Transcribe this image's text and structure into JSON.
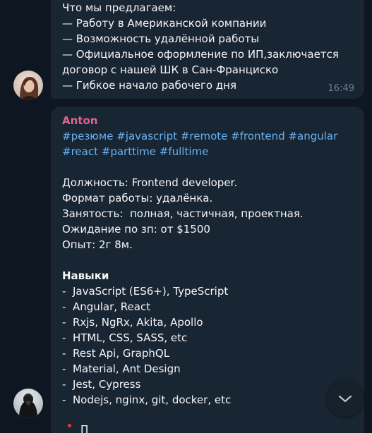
{
  "message1": {
    "lines": [
      "Что мы предлагаем:",
      "— Работу в Американской компании",
      "— Возможность удалённой работы",
      "— Официальное оформление по ИП,заключается",
      "договор с нашей ШК в Сан-Франциско",
      "— Гибкое начало рабочего дня"
    ],
    "time": "16:49",
    "avatar_icon": "avatar-photo-woman"
  },
  "message2": {
    "sender": "Anton",
    "hashtags_line1": [
      "#резюме",
      "#javascript",
      "#remote",
      "#frontend",
      "#angular"
    ],
    "hashtags_line2": [
      "#react",
      "#parttime",
      "#fulltime"
    ],
    "details": [
      "Должность: Frontend developer.",
      "Формат работы: удалёнка.",
      "Занятость:  полная, частичная, проектная.",
      "Ожидание по зп: от $1500",
      "Опыт: 2г 8м."
    ],
    "skills_heading": "Навыки",
    "skills": [
      "-  JavaScript (ES6+), TypeScript",
      "-  Angular, React",
      "-  Rxjs, NgRx, Akita, Apollo",
      "-  HTML, CSS, SASS, etc",
      "-  Rest Api, GraphQL",
      "-  Material, Ant Design",
      "-  Jest, Cypress",
      "-  Nodejs, nginx, git, docker, etc"
    ],
    "cut_text": "П",
    "avatar_icon": "avatar-photo-dark-figure"
  },
  "scroll_button": {
    "icon": "chevron-down-icon"
  },
  "colors": {
    "background": "#0e1621",
    "bubble": "#182533",
    "sender": "#e3628f",
    "hashtag": "#6ab2f2",
    "time": "#6d7f8f",
    "text": "#f5f5f5"
  }
}
